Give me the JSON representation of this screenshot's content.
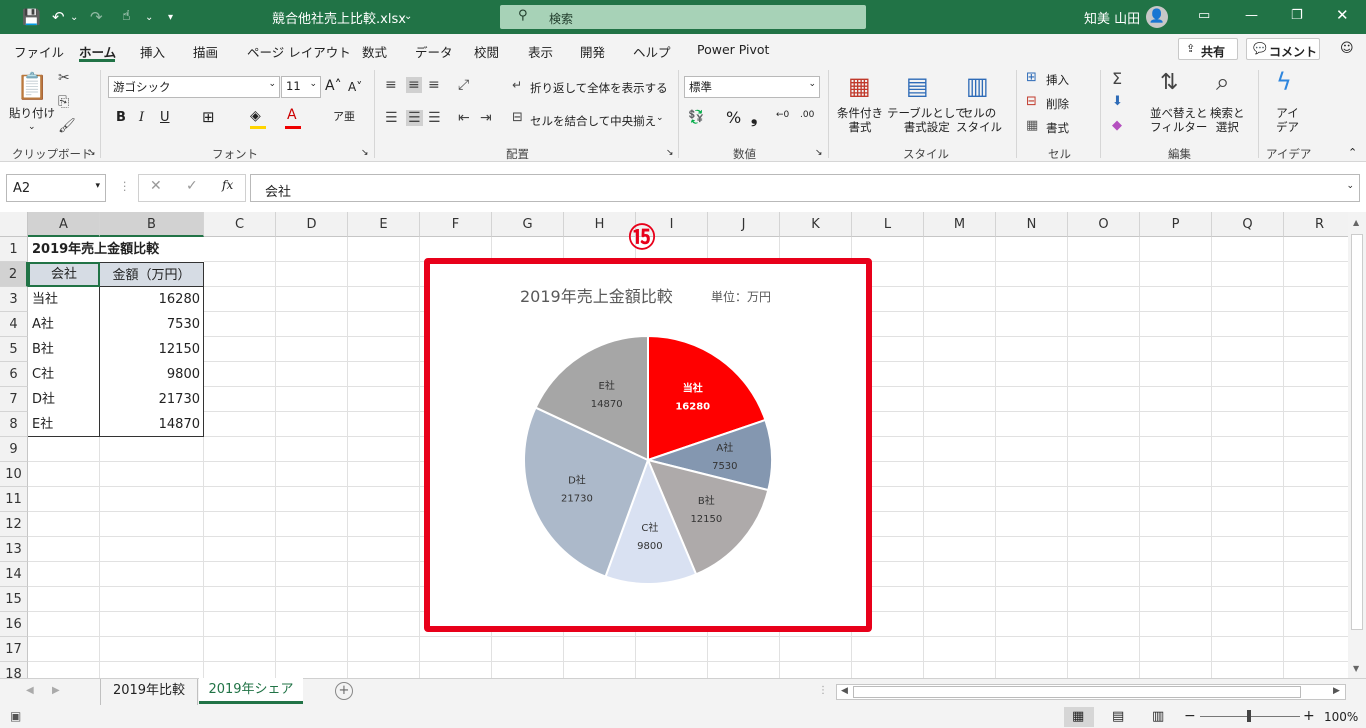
{
  "titlebar": {
    "filename": "競合他社売上比較.xlsx",
    "search_placeholder": "検索",
    "user": "知美 山田"
  },
  "menu": [
    "ファイル",
    "ホーム",
    "挿入",
    "描画",
    "ページ レイアウト",
    "数式",
    "データ",
    "校閲",
    "表示",
    "開発",
    "ヘルプ",
    "Power Pivot"
  ],
  "share_label": "共有",
  "comment_label": "コメント",
  "ribbon": {
    "paste": "貼り付け",
    "font_name": "游ゴシック",
    "font_size": "11",
    "wrap_text": "折り返して全体を表示する",
    "merge_center": "セルを結合して中央揃え",
    "number_format": "標準",
    "cond_format": "条件付き\n書式",
    "table_format": "テーブルとして\n書式設定",
    "cell_style": "セルの\nスタイル",
    "insert": "挿入",
    "delete": "削除",
    "format": "書式",
    "sort_filter": "並べ替えと\nフィルター",
    "find_select": "検索と\n選択",
    "ideas": "アイ\nデア",
    "groups": [
      "クリップボード",
      "フォント",
      "配置",
      "数値",
      "スタイル",
      "セル",
      "編集",
      "アイデア"
    ]
  },
  "formula": {
    "namebox": "A2",
    "content": "会社"
  },
  "columns": [
    "A",
    "B",
    "C",
    "D",
    "E",
    "F",
    "G",
    "H",
    "I",
    "J",
    "K",
    "L",
    "M",
    "N",
    "O",
    "P",
    "Q",
    "R"
  ],
  "rows": [
    "1",
    "2",
    "3",
    "4",
    "5",
    "6",
    "7",
    "8",
    "9",
    "10",
    "11",
    "12",
    "13",
    "14",
    "15",
    "16",
    "17",
    "18"
  ],
  "table": {
    "title": "2019年売上金額比較",
    "headers": [
      "会社",
      "金額（万円）"
    ],
    "rows": [
      [
        "当社",
        "16280"
      ],
      [
        "A社",
        "7530"
      ],
      [
        "B社",
        "12150"
      ],
      [
        "C社",
        "9800"
      ],
      [
        "D社",
        "21730"
      ],
      [
        "E社",
        "14870"
      ]
    ]
  },
  "callout": "⑮",
  "chart_data": {
    "type": "pie",
    "title": "2019年売上金額比較",
    "subtitle": "単位：万円",
    "categories": [
      "当社",
      "A社",
      "B社",
      "C社",
      "D社",
      "E社"
    ],
    "values": [
      16280,
      7530,
      12150,
      9800,
      21730,
      14870
    ],
    "colors": [
      "#ff0000",
      "#8497b0",
      "#aeaaaa",
      "#d9e1f2",
      "#acb9ca",
      "#a6a6a6"
    ],
    "label_colors": [
      "#ffffff",
      "#333333",
      "#333333",
      "#333333",
      "#333333",
      "#333333"
    ]
  },
  "tabs": [
    "2019年比較",
    "2019年シェア"
  ],
  "active_tab": "2019年シェア",
  "status": {
    "zoom": "100%"
  }
}
